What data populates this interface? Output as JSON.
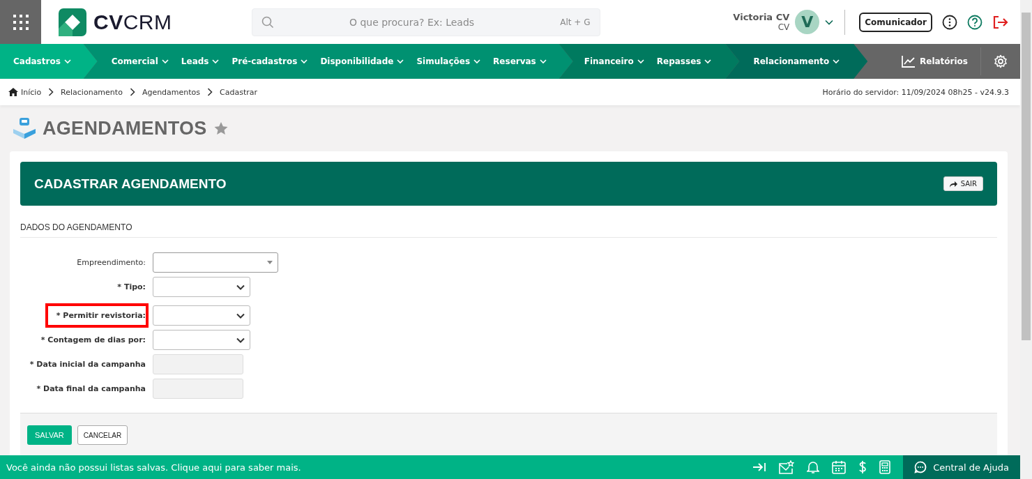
{
  "logo": {
    "bold": "CV",
    "light": "CRM"
  },
  "header": {
    "search": {
      "placeholder": "O que procura? Ex: Leads",
      "shortcut": "Alt + G"
    },
    "user": {
      "name": "Victoria CV",
      "role": "CV",
      "initial": "V"
    },
    "communicator": "Comunicador"
  },
  "nav": {
    "groups": [
      {
        "color": "#00b386",
        "items": [
          "Cadastros"
        ]
      },
      {
        "color": "#009171",
        "items": [
          "Comercial",
          "Leads",
          "Pré-cadastros",
          "Disponibilidade",
          "Simulações",
          "Reservas"
        ]
      },
      {
        "color": "#007a5f",
        "items": [
          "Financeiro",
          "Repasses"
        ]
      },
      {
        "color": "#006b5a",
        "items": [
          "Relacionamento"
        ]
      }
    ],
    "reports": "Relatórios"
  },
  "breadcrumb": [
    "Início",
    "Relacionamento",
    "Agendamentos",
    "Cadastrar"
  ],
  "server_time": "Horário do servidor: 11/09/2024 08h25 - v24.9.3",
  "page_title": "AGENDAMENTOS",
  "form": {
    "title": "CADASTRAR AGENDAMENTO",
    "exit": "SAIR",
    "section": "DADOS DO AGENDAMENTO",
    "fields": [
      {
        "kind": "combo",
        "label": "Empreendimento:",
        "required": false,
        "highlighted": false
      },
      {
        "kind": "select",
        "label": "* Tipo:",
        "required": true,
        "highlighted": false
      },
      {
        "kind": "select",
        "label": "* Permitir revistoria:",
        "required": true,
        "highlighted": true
      },
      {
        "kind": "select",
        "label": "* Contagem de dias por:",
        "required": true,
        "highlighted": false
      },
      {
        "kind": "input",
        "label": "* Data inicial da campanha",
        "required": true,
        "highlighted": false,
        "disabled": true
      },
      {
        "kind": "input",
        "label": "* Data final da campanha",
        "required": true,
        "highlighted": false,
        "disabled": true
      }
    ],
    "save": "SALVAR",
    "cancel": "CANCELAR"
  },
  "footer": {
    "message": "Você ainda não possui listas salvas. Clique aqui para saber mais.",
    "help": "Central de Ajuda"
  }
}
